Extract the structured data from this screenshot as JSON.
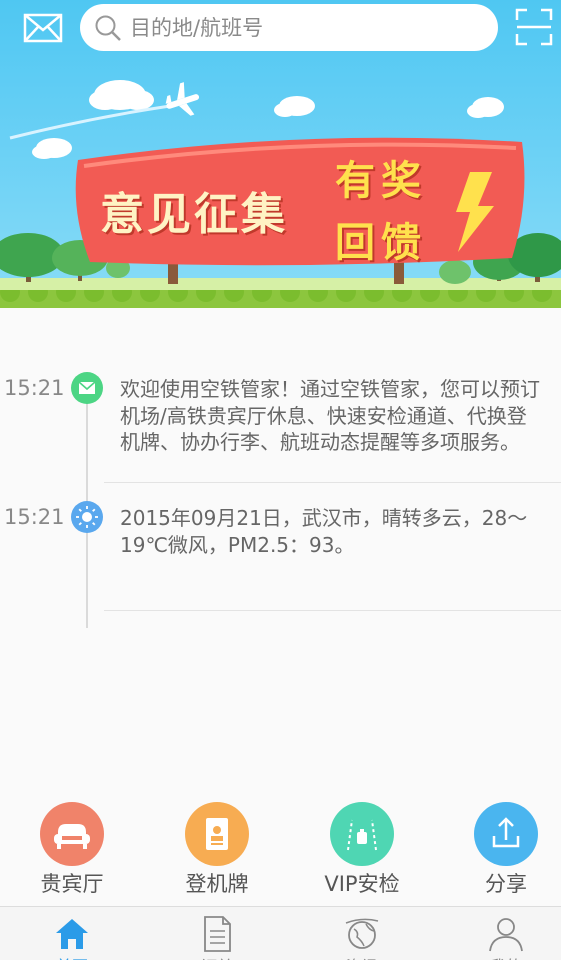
{
  "search": {
    "placeholder": "目的地/航班号"
  },
  "banner": {
    "text_left": "意见征集",
    "text_right_line1": "有奖",
    "text_right_line2": "回馈"
  },
  "timeline": [
    {
      "time": "15:21",
      "icon": "mail-icon",
      "color": "#4cd584",
      "text": "欢迎使用空铁管家！通过空铁管家，您可以预订机场/高铁贵宾厅休息、快速安检通道、代换登机牌、协办行李、航班动态提醒等多项服务。"
    },
    {
      "time": "15:21",
      "icon": "sun-icon",
      "color": "#5aa8ee",
      "text": "2015年09月21日，武汉市，晴转多云，28～19℃微风，PM2.5：93。"
    }
  ],
  "services": [
    {
      "label": "贵宾厅",
      "icon": "sofa-icon",
      "color": "#f0836a"
    },
    {
      "label": "登机牌",
      "icon": "boarding-pass-icon",
      "color": "#f7ac52"
    },
    {
      "label": "VIP安检",
      "icon": "security-check-icon",
      "color": "#4fd6b3"
    },
    {
      "label": "分享",
      "icon": "share-icon",
      "color": "#4ab5ef"
    }
  ],
  "tabs": [
    {
      "label": "首页",
      "icon": "home-icon",
      "active": true
    },
    {
      "label": "订单",
      "icon": "document-icon",
      "active": false
    },
    {
      "label": "资讯",
      "icon": "globe-icon",
      "active": false
    },
    {
      "label": "我的",
      "icon": "user-icon",
      "active": false
    }
  ],
  "colors": {
    "accent": "#2b9be8",
    "banner_sky": "#4fc7f2"
  }
}
